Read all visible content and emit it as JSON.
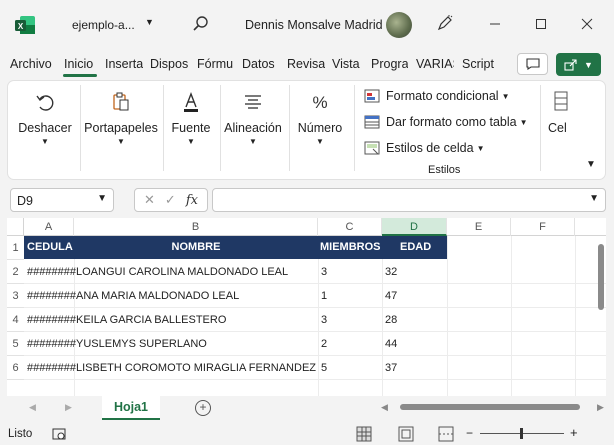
{
  "titlebar": {
    "file_name": "ejemplo-a...",
    "user_name": "Dennis Monsalve Madrid"
  },
  "tabs": [
    "Archivo",
    "Inicio",
    "Inserta",
    "Dispos",
    "Fórmu",
    "Datos",
    "Revisa",
    "Vista",
    "Progra",
    "VARIAS",
    "Script"
  ],
  "ribbon": {
    "deshacer": "Deshacer",
    "portapapeles": "Portapapeles",
    "fuente": "Fuente",
    "alineacion": "Alineación",
    "numero": "Número",
    "formato_condicional": "Formato condicional",
    "dar_formato_tabla": "Dar formato como tabla",
    "estilos_celda": "Estilos de celda",
    "estilos_group": "Estilos",
    "celdas": "Cel"
  },
  "formula_bar": {
    "name_box": "D9",
    "formula": ""
  },
  "columns": [
    "A",
    "B",
    "C",
    "D",
    "E",
    "F"
  ],
  "selected_column": "D",
  "rows": [
    "1",
    "2",
    "3",
    "4",
    "5",
    "6"
  ],
  "table": {
    "headers": [
      "CEDULA",
      "NOMBRE",
      "MIEMBROS",
      "EDAD"
    ],
    "data": [
      [
        "########",
        "LOANGUI CAROLINA MALDONADO LEAL",
        "3",
        "32"
      ],
      [
        "########",
        "ANA MARIA MALDONADO LEAL",
        "1",
        "47"
      ],
      [
        "########",
        "KEILA GARCIA BALLESTERO",
        "3",
        "28"
      ],
      [
        "########",
        "YUSLEMYS SUPERLANO",
        "2",
        "44"
      ],
      [
        "########",
        "LISBETH COROMOTO MIRAGLIA FERNANDEZ",
        "5",
        "37"
      ]
    ]
  },
  "sheet_tab": "Hoja1",
  "status": "Listo",
  "colors": {
    "accent": "#217346",
    "header_band": "#1f3864"
  }
}
